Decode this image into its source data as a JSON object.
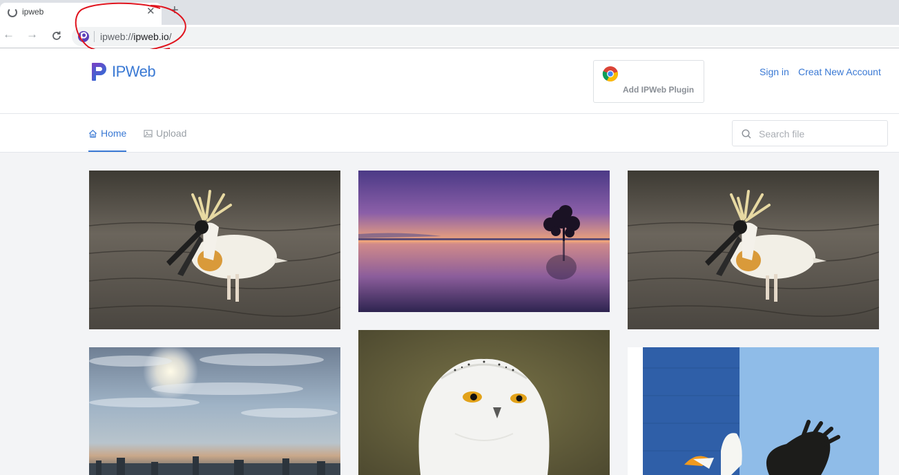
{
  "browser": {
    "tab_title": "ipweb",
    "url_scheme": "ipweb://",
    "url_host": "ipweb.io",
    "url_path": "/"
  },
  "header": {
    "logo_text": "IPWeb",
    "plugin_label": "Add IPWeb Plugin",
    "signin_label": "Sign in",
    "create_account_label": "Creat New Account"
  },
  "nav": {
    "home_label": "Home",
    "upload_label": "Upload",
    "search_placeholder": "Search file"
  },
  "gallery": {
    "images": [
      {
        "subject": "spoonbill"
      },
      {
        "subject": "sunset-lake-tree"
      },
      {
        "subject": "spoonbill"
      },
      {
        "subject": "cloudy-sky-city"
      },
      {
        "subject": "snowy-owl"
      },
      {
        "subject": "eagle"
      }
    ]
  },
  "colors": {
    "accent": "#3a79d4",
    "annotation": "#e0141e"
  }
}
